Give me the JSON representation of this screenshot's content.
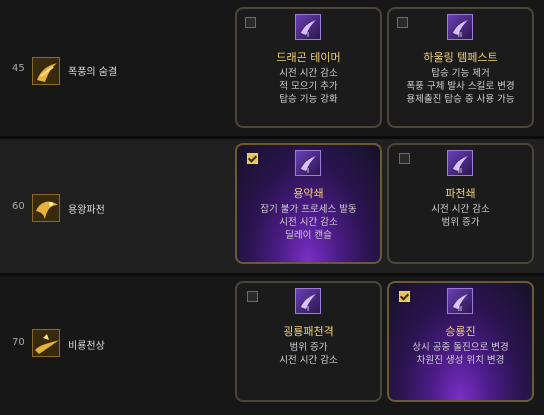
{
  "rows": [
    {
      "level": "45",
      "skill_name": "폭풍의 숨결",
      "options": [
        {
          "title": "드래곤 테이머",
          "lines": [
            "시전 시간 감소",
            "적 모으기 추가",
            "탑승 기능 강화"
          ],
          "checked": false,
          "tier": "I"
        },
        {
          "title": "하울링 템페스트",
          "lines": [
            "탑승 기능 제거",
            "폭풍 구체 발사 스킬로 변경",
            "용제출진 탑승 중 사용 가능"
          ],
          "checked": false,
          "tier": "II"
        }
      ]
    },
    {
      "level": "60",
      "skill_name": "용왕파천",
      "options": [
        {
          "title": "용약쇄",
          "lines": [
            "잡기 불가 프로세스 발동",
            "시전 시간 감소",
            "딜레이 캔슬"
          ],
          "checked": true,
          "tier": "I"
        },
        {
          "title": "파천쇄",
          "lines": [
            "시전 시간 감소",
            "범위 증가"
          ],
          "checked": false,
          "tier": "II"
        }
      ]
    },
    {
      "level": "70",
      "skill_name": "비룡천상",
      "options": [
        {
          "title": "굉룡패천격",
          "lines": [
            "범위 증가",
            "시전 시간 감소"
          ],
          "checked": false,
          "tier": "I"
        },
        {
          "title": "승룡진",
          "lines": [
            "상시 공중 돌진으로 변경",
            "차원진 생성 위치 변경"
          ],
          "checked": true,
          "tier": "II"
        }
      ]
    }
  ],
  "colors": {
    "gold_title": "#f2d27a",
    "check_gold": "#e5c25a",
    "selected_purple": "#7b2fc9"
  },
  "icons": {
    "skill_icon": "gold-dragon-skill-icon",
    "rune_icon": "purple-tripod-rune-icon"
  }
}
